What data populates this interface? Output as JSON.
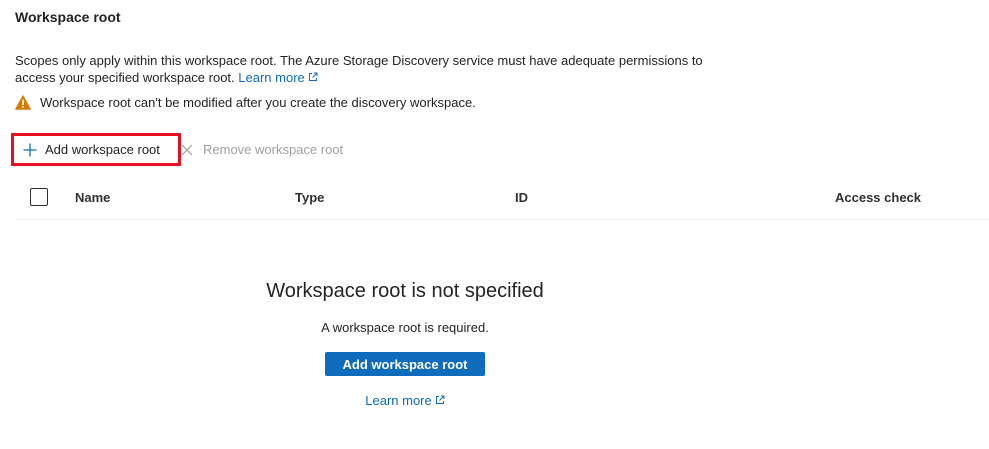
{
  "section": {
    "title": "Workspace root"
  },
  "description": {
    "text": "Scopes only apply within this workspace root. The Azure Storage Discovery service must have adequate permissions to access your specified workspace root.",
    "learn_more": "Learn more"
  },
  "warning": {
    "text": "Workspace root can't be modified after you create the discovery workspace.",
    "icon": "warning-icon",
    "color": "#d67a00"
  },
  "toolbar": {
    "add_label": "Add workspace root",
    "remove_label": "Remove workspace root",
    "highlight_color": "#e81123"
  },
  "table": {
    "columns": [
      "Name",
      "Type",
      "ID",
      "Access check"
    ]
  },
  "empty_state": {
    "title": "Workspace root is not specified",
    "subtitle": "A workspace root is required.",
    "button_label": "Add workspace root",
    "learn_more": "Learn more",
    "button_color": "#0f6cbd"
  }
}
